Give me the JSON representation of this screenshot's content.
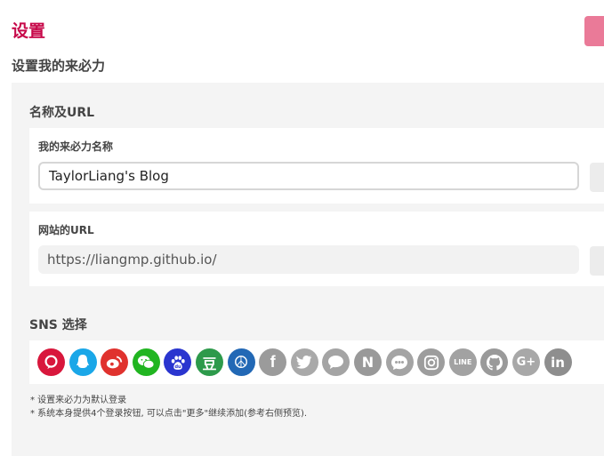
{
  "header": {
    "title": "设置"
  },
  "section": {
    "title": "设置我的来必力"
  },
  "name_group": {
    "title": "名称及URL",
    "site_name": {
      "label": "我的来必力名称",
      "value": "TaylorLiang's Blog"
    },
    "site_url": {
      "label": "网站的URL",
      "value": "https://liangmp.github.io/"
    }
  },
  "sns": {
    "title": "SNS 选择",
    "icons": [
      {
        "name": "kakao-icon",
        "glyph": "",
        "color": "#d8173c",
        "enabled": true
      },
      {
        "name": "qq-icon",
        "glyph": "",
        "color": "#1aa7e8",
        "enabled": true
      },
      {
        "name": "weibo-icon",
        "glyph": "",
        "color": "#e0322e",
        "enabled": true
      },
      {
        "name": "wechat-icon",
        "glyph": "",
        "color": "#21b521",
        "enabled": true
      },
      {
        "name": "baidu-icon",
        "glyph": "",
        "color": "#2a35cf",
        "enabled": true
      },
      {
        "name": "douban-icon",
        "glyph": "豆",
        "color": "#2d9a4b",
        "enabled": true
      },
      {
        "name": "peace-icon",
        "glyph": "☮",
        "color": "#2268b5",
        "enabled": true
      },
      {
        "name": "facebook-icon",
        "glyph": "f",
        "color": "#9b9b9b",
        "enabled": false
      },
      {
        "name": "twitter-icon",
        "glyph": "",
        "color": "#a9a9a9",
        "enabled": false
      },
      {
        "name": "message-icon",
        "glyph": "",
        "color": "#a4a4a4",
        "enabled": false
      },
      {
        "name": "naver-icon",
        "glyph": "N",
        "color": "#999999",
        "enabled": false
      },
      {
        "name": "dots-icon",
        "glyph": "",
        "color": "#a4a4a4",
        "enabled": false
      },
      {
        "name": "instagram-icon",
        "glyph": "",
        "color": "#9d9d9d",
        "enabled": false
      },
      {
        "name": "line-icon",
        "glyph": "LINE",
        "color": "#a2a2a2",
        "enabled": false
      },
      {
        "name": "github-icon",
        "glyph": "",
        "color": "#9a9a9a",
        "enabled": false
      },
      {
        "name": "google-plus-icon",
        "glyph": "G+",
        "color": "#a8a8a8",
        "enabled": false
      },
      {
        "name": "linkedin-icon",
        "glyph": "in",
        "color": "#8e8e8e",
        "enabled": false
      }
    ]
  },
  "notes": [
    "* 设置来必力为默认登录",
    "* 系统本身提供4个登录按钮, 可以点击\"更多\"继续添加(参考右侧预览)."
  ],
  "colors": {
    "accent": "#c7094a",
    "button": "#ea7a98"
  }
}
